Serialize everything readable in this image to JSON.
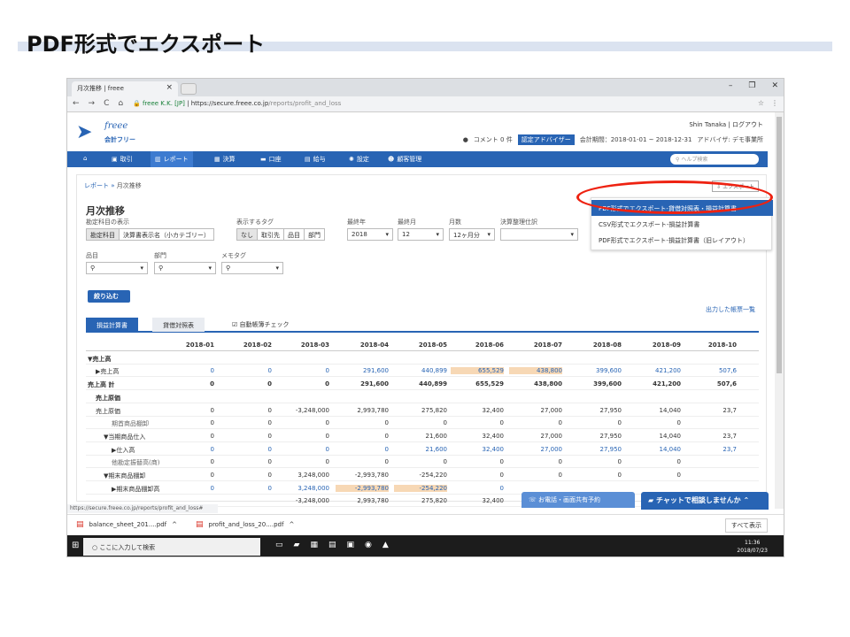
{
  "slide": {
    "title": "PDF形式でエクスポート"
  },
  "browser": {
    "tab_title": "月次推移 | freee",
    "tab_close": "×",
    "nav_back": "←",
    "nav_forward": "→",
    "nav_reload": "C",
    "nav_home": "⌂",
    "site_id": "freee K.K. [JP]",
    "url_host": "https://secure.freee.co.jp",
    "url_path": "/reports/profit_and_loss",
    "status_url": "https://secure.freee.co.jp/reports/profit_and_loss#",
    "win_min": "–",
    "win_max": "❐",
    "win_close": "✕"
  },
  "header": {
    "logo_script": "freee",
    "logo_sub": "会計フリー",
    "user_name": "Shin Tanaka",
    "logout": "ログアウト",
    "comments": "コメント 0 件",
    "adviser_badge": "認定アドバイザー",
    "period": "会計期間：2018-01-01 ~ 2018-12-31",
    "adviser": "アドバイザ: デモ事業所"
  },
  "nav": {
    "items": [
      "取引",
      "レポート",
      "決算",
      "口座",
      "給与",
      "設定",
      "顧客管理"
    ],
    "help_placeholder": "ヘルプ検索"
  },
  "page": {
    "crumb_root": "レポート",
    "crumb_sep": "»",
    "crumb_current": "月次推移",
    "export_btn": "エクスポート",
    "title": "月次推移"
  },
  "export_menu": {
    "items": [
      "PDF形式でエクスポート-貸借対照表・損益計算書",
      "CSV形式でエクスポート-損益計算書",
      "PDF形式でエクスポート-損益計算書（旧レイアウト）"
    ]
  },
  "filters": {
    "account_display_label": "勘定科目の表示",
    "account_display_options": [
      "勘定科目",
      "決算書表示名（小カテゴリー）"
    ],
    "tag_label": "表示するタグ",
    "tag_options": [
      "なし",
      "取引先",
      "品目",
      "部門"
    ],
    "final_year_label": "最終年",
    "final_year": "2018",
    "final_month_label": "最終月",
    "final_month": "12",
    "months_label": "月数",
    "months": "12ヶ月分",
    "closing_label": "決算整理仕訳",
    "item_label": "品目",
    "dept_label": "部門",
    "memo_label": "メモタグ",
    "filter_btn": "絞り込む",
    "report_list_link": "出力した帳票一覧"
  },
  "report_tabs": {
    "pl": "損益計算書",
    "bs": "貸借対照表",
    "check": "自動帳簿チェック"
  },
  "table": {
    "columns": [
      "2018-01",
      "2018-02",
      "2018-03",
      "2018-04",
      "2018-05",
      "2018-06",
      "2018-07",
      "2018-08",
      "2018-09",
      "2018-10"
    ],
    "rows": [
      {
        "label": "▼売上高",
        "indent": 0,
        "bold": true,
        "values": []
      },
      {
        "label": "▶売上高",
        "indent": 1,
        "blue": true,
        "values": [
          "0",
          "0",
          "0",
          "291,600",
          "440,899",
          "655,529",
          "438,800",
          "399,600",
          "421,200",
          "507,6"
        ],
        "hl": [
          5,
          6
        ]
      },
      {
        "label": "売上高 計",
        "indent": 0,
        "bold": true,
        "values": [
          "0",
          "0",
          "0",
          "291,600",
          "440,899",
          "655,529",
          "438,800",
          "399,600",
          "421,200",
          "507,6"
        ]
      },
      {
        "label": "売上原価",
        "indent": 1,
        "bold": true,
        "values": []
      },
      {
        "label": "売上原価",
        "indent": 1,
        "values": [
          "0",
          "0",
          "-3,248,000",
          "2,993,780",
          "275,820",
          "32,400",
          "27,000",
          "27,950",
          "14,040",
          "23,7"
        ]
      },
      {
        "label": "期首商品棚卸",
        "indent": 3,
        "values": [
          "0",
          "0",
          "0",
          "0",
          "0",
          "0",
          "0",
          "0",
          "0",
          ""
        ]
      },
      {
        "label": "▼当期商品仕入",
        "indent": 2,
        "values": [
          "0",
          "0",
          "0",
          "0",
          "21,600",
          "32,400",
          "27,000",
          "27,950",
          "14,040",
          "23,7"
        ]
      },
      {
        "label": "▶仕入高",
        "indent": 3,
        "blue": true,
        "values": [
          "0",
          "0",
          "0",
          "0",
          "21,600",
          "32,400",
          "27,000",
          "27,950",
          "14,040",
          "23,7"
        ]
      },
      {
        "label": "他勘定振替高(商)",
        "indent": 3,
        "values": [
          "0",
          "0",
          "0",
          "0",
          "0",
          "0",
          "0",
          "0",
          "0",
          ""
        ]
      },
      {
        "label": "▼期末商品棚卸",
        "indent": 2,
        "values": [
          "0",
          "0",
          "3,248,000",
          "-2,993,780",
          "-254,220",
          "0",
          "0",
          "0",
          "0",
          ""
        ]
      },
      {
        "label": "▶期末商品棚卸高",
        "indent": 3,
        "blue": true,
        "values": [
          "0",
          "0",
          "3,248,000",
          "-2,993,780",
          "-254,220",
          "0",
          "",
          "",
          "",
          ""
        ],
        "hl": [
          3,
          4
        ]
      },
      {
        "label": "",
        "indent": 0,
        "values": [
          "",
          "",
          "-3,248,000",
          "2,993,780",
          "275,820",
          "32,400",
          "",
          "",
          "",
          ""
        ]
      }
    ]
  },
  "floating": {
    "call": "お電話・画面共有予約",
    "chat": "チャットで相談しませんか"
  },
  "downloads": {
    "files": [
      "balance_sheet_201....pdf",
      "profit_and_loss_20....pdf"
    ],
    "show_all": "すべて表示"
  },
  "taskbar": {
    "search": "ここに入力して検索",
    "time": "11:36",
    "date": "2018/07/23"
  }
}
